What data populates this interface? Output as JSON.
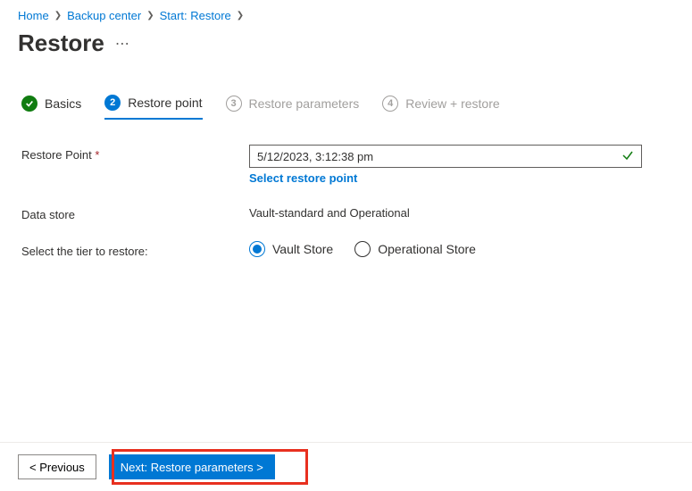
{
  "breadcrumb": {
    "items": [
      "Home",
      "Backup center",
      "Start: Restore"
    ]
  },
  "page": {
    "title": "Restore"
  },
  "wizard": {
    "steps": [
      {
        "num": "✓",
        "label": "Basics"
      },
      {
        "num": "2",
        "label": "Restore point"
      },
      {
        "num": "3",
        "label": "Restore parameters"
      },
      {
        "num": "4",
        "label": "Review + restore"
      }
    ]
  },
  "form": {
    "restorePoint": {
      "label": "Restore Point",
      "value": "5/12/2023, 3:12:38 pm",
      "link": "Select restore point"
    },
    "dataStore": {
      "label": "Data store",
      "value": "Vault-standard and Operational"
    },
    "tier": {
      "label": "Select the tier to restore:",
      "options": [
        "Vault Store",
        "Operational Store"
      ]
    }
  },
  "footer": {
    "prev": "< Previous",
    "next": "Next: Restore parameters >"
  }
}
